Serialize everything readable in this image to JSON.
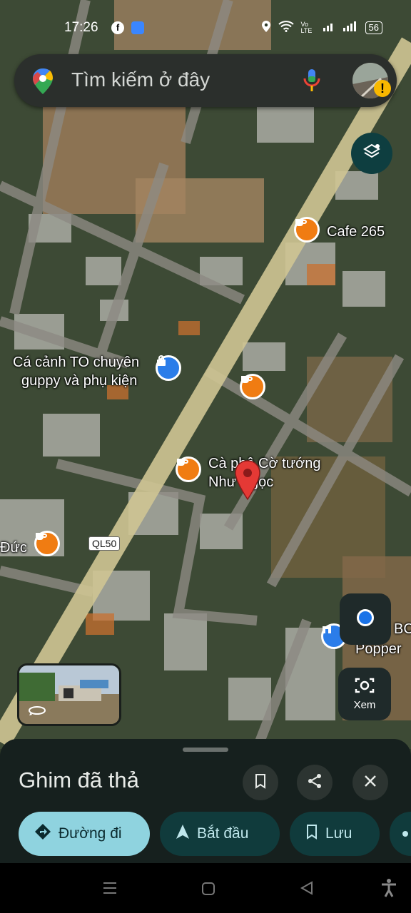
{
  "status_bar": {
    "time": "17:26",
    "battery": "56",
    "volte": "Vo LTE"
  },
  "search": {
    "placeholder": "Tìm kiếm ở đây"
  },
  "map": {
    "pois": [
      {
        "name": "Cafe 265",
        "type": "cafe"
      },
      {
        "name": "Cá cảnh TO chuyên guppy và phụ kiện",
        "type": "shop"
      },
      {
        "name": "",
        "type": "cafe"
      },
      {
        "name": "Cà phê Cờ tướng Như Ngọc",
        "type": "cafe"
      },
      {
        "name": "Đức",
        "type": "cafe"
      },
      {
        "name": "BC Popper",
        "type": "shop"
      }
    ],
    "label_cafe265": "Cafe 265",
    "label_caca_line1": "Cá cảnh TO chuyên",
    "label_caca_line2": "guppy và phụ kiện",
    "label_caphe_line1": "Cà phê Cờ tướng",
    "label_caphe_line2": "Như Ngọc",
    "label_duc": "Đức",
    "label_bc_line1": "BC",
    "label_bc_line2": "Popper",
    "road_label": "QL50"
  },
  "controls": {
    "xem_label": "Xem"
  },
  "sheet": {
    "title": "Ghim đã thả",
    "directions_label": "Đường đi",
    "start_label": "Bắt đầu",
    "save_label": "Lưu"
  },
  "colors": {
    "cafe": "#f07c12",
    "shop": "#2b7de9",
    "pin": "#e53935",
    "accent": "#8fd3df"
  }
}
